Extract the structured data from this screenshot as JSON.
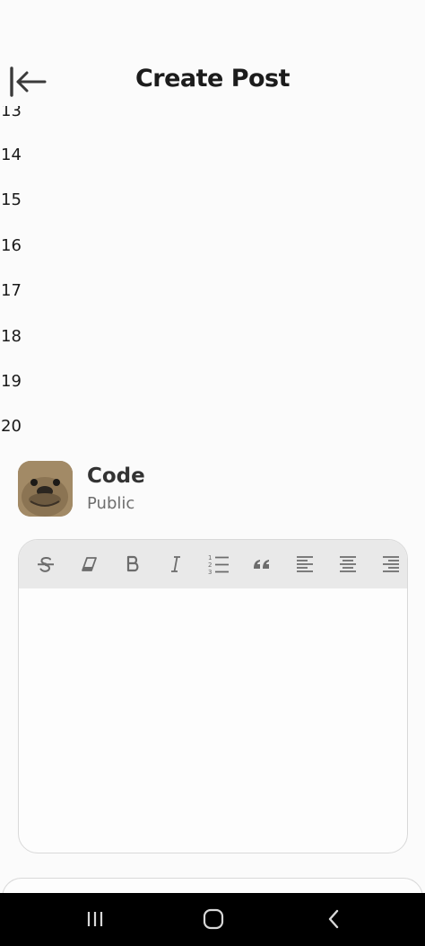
{
  "header": {
    "title": "Create Post",
    "back_icon": "collapse-left-icon"
  },
  "line_numbers": [
    "13",
    "14",
    "15",
    "16",
    "17",
    "18",
    "19",
    "20"
  ],
  "author": {
    "name": "Code",
    "visibility": "Public",
    "avatar_icon": "sea-lion-avatar"
  },
  "toolbar": {
    "tools": [
      "strikethrough-icon",
      "eraser-icon",
      "bold-icon",
      "italic-icon",
      "ordered-list-icon",
      "quote-icon",
      "align-left-icon",
      "align-center-icon",
      "align-right-icon"
    ]
  },
  "navbar": {
    "buttons": [
      "recent-apps-icon",
      "home-icon",
      "back-icon"
    ]
  },
  "colors": {
    "background": "#fbfbfb",
    "toolbar": "#e9e9e9",
    "navbar": "#000000",
    "icon": "#6c6c6c"
  }
}
